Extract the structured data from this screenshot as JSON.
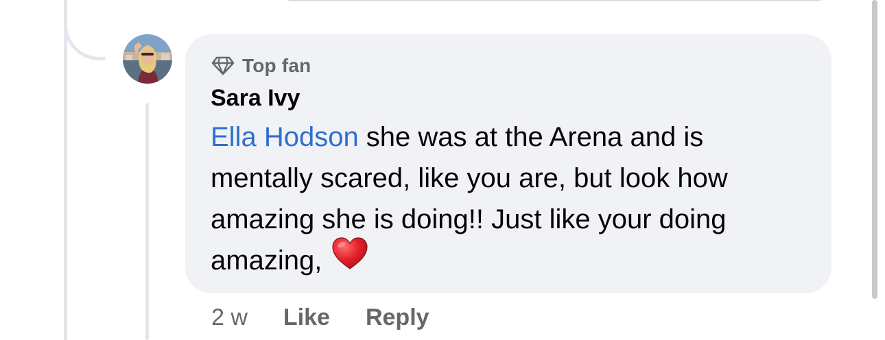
{
  "comment": {
    "badge": {
      "icon": "diamond-icon",
      "label": "Top fan"
    },
    "author": "Sara Ivy",
    "mention": "Ella Hodson",
    "line1_rest": " she was at the Arena and is",
    "line2": "mentally scared, like you are, but look how",
    "line3": "amazing she is doing!! Just like your doing",
    "line4": "amazing,",
    "emoji": "heart-emoji",
    "timestamp": "2 w",
    "like_label": "Like",
    "reply_label": "Reply"
  },
  "colors": {
    "bubble_bg": "#f0f2f5",
    "mention": "#2e6fcf",
    "secondary_text": "#65676b",
    "primary_text": "#050505",
    "heart": "#e0202b"
  }
}
